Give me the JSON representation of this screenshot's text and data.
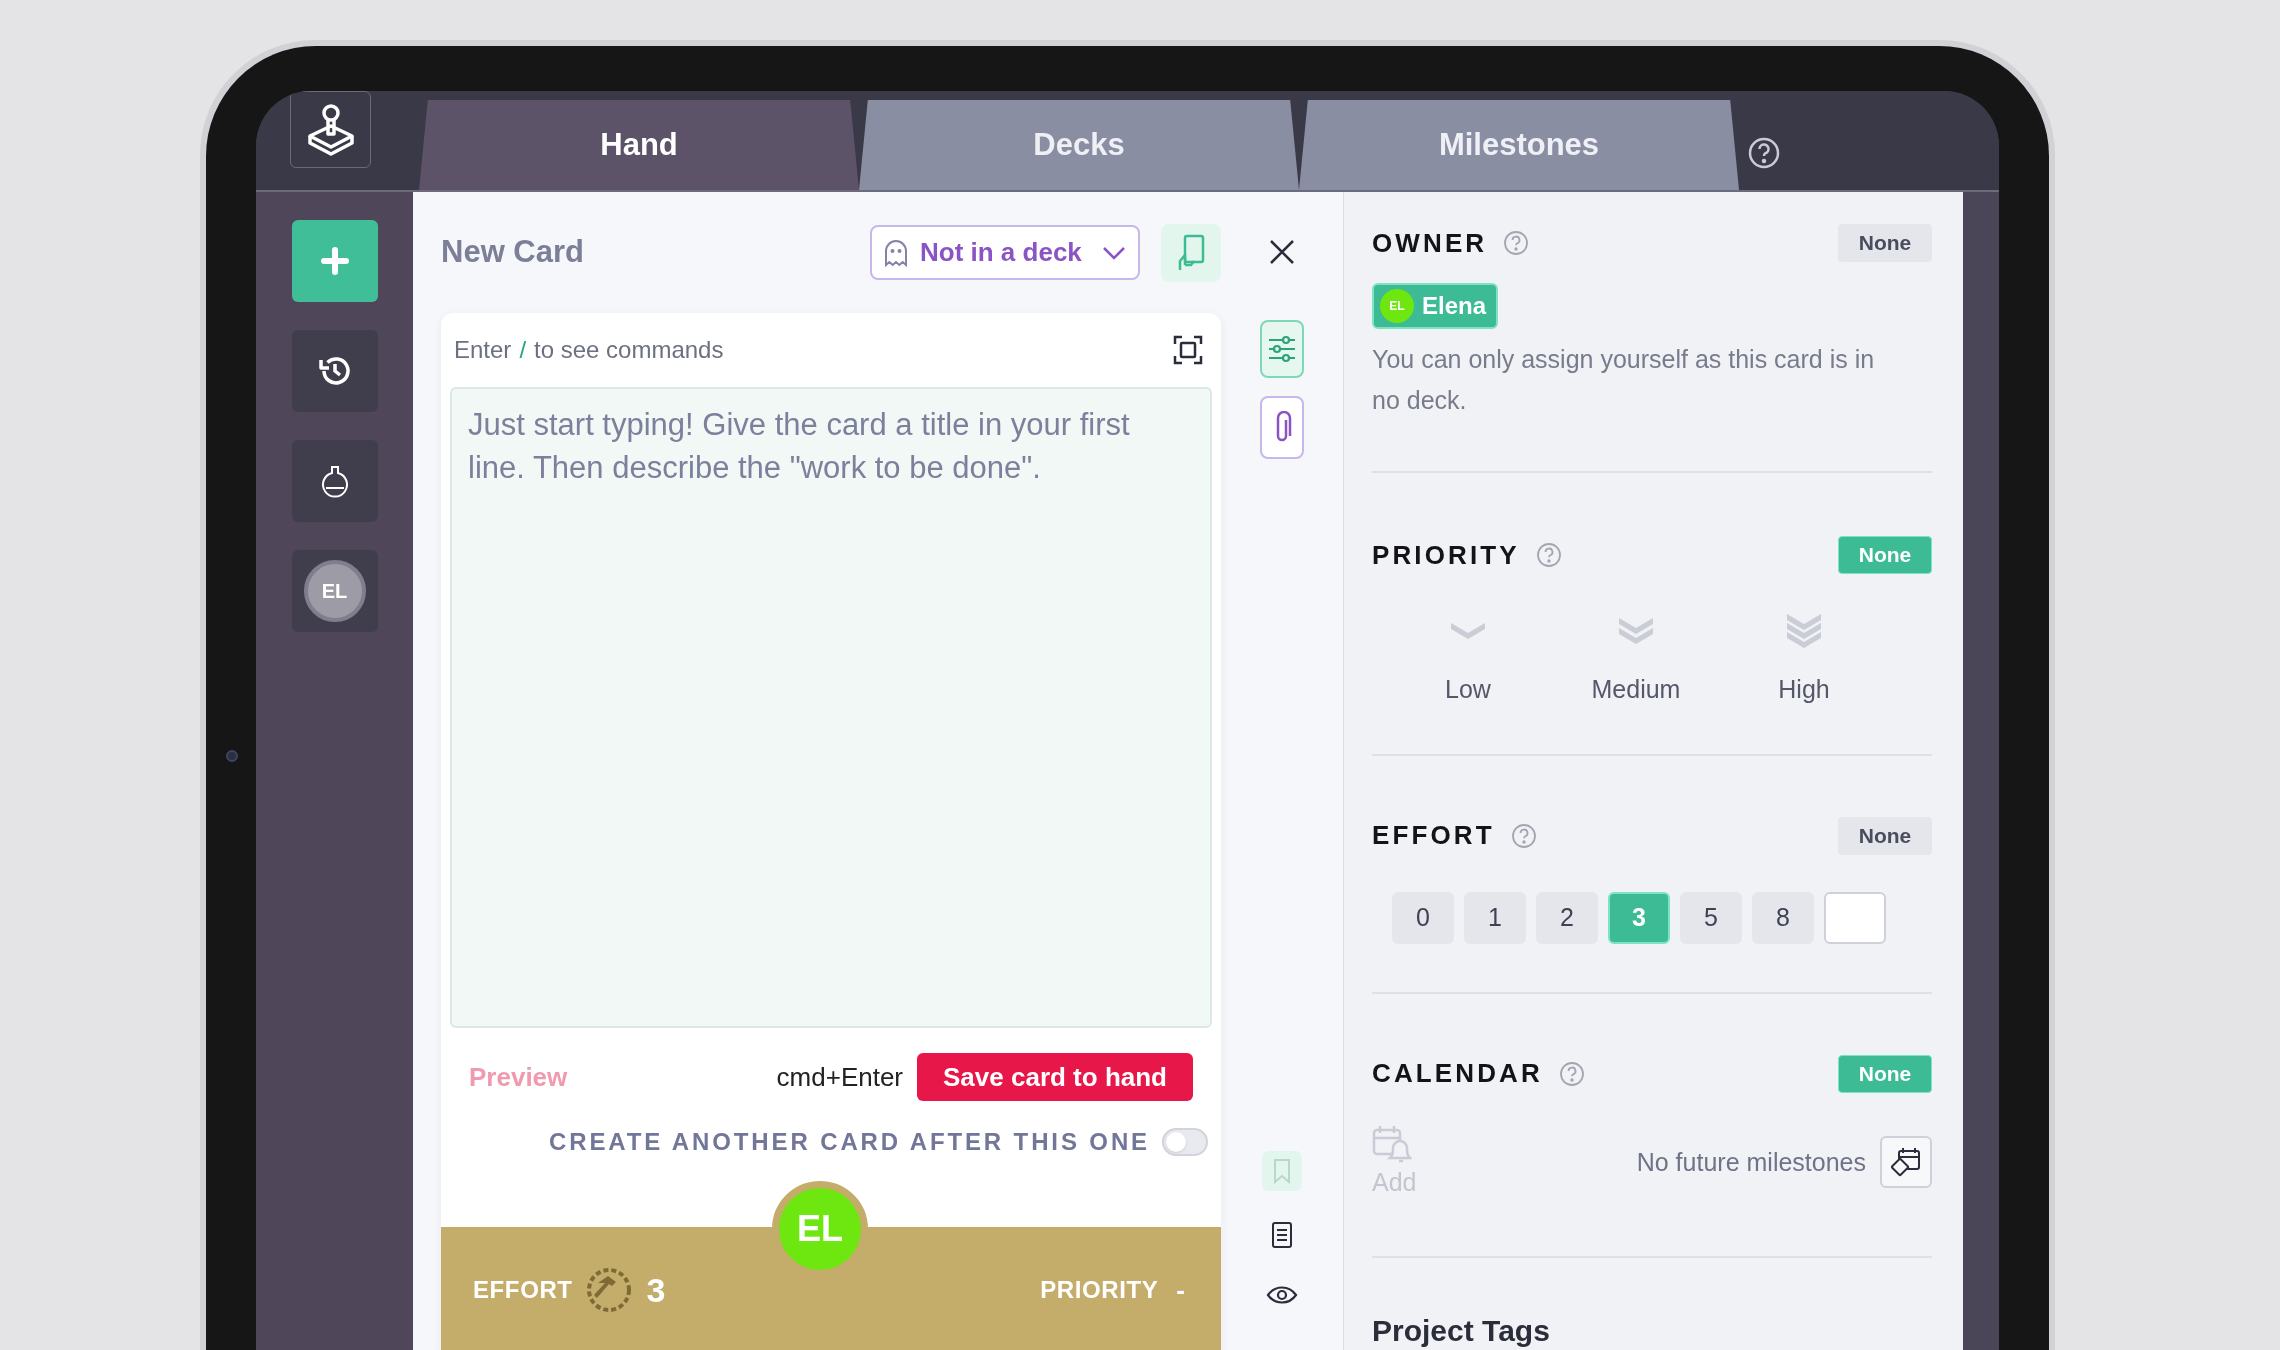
{
  "app_bar": {
    "tabs": [
      {
        "label": "Hand",
        "selected": true
      },
      {
        "label": "Decks",
        "selected": false
      },
      {
        "label": "Milestones",
        "selected": false
      }
    ]
  },
  "sidebar": {
    "items": [
      {
        "kind": "add",
        "selected": true
      },
      {
        "kind": "history",
        "selected": false
      },
      {
        "kind": "flask",
        "selected": false
      },
      {
        "kind": "avatar",
        "initials": "EL",
        "selected": false
      }
    ]
  },
  "card": {
    "title": "New Card",
    "deck_select": {
      "value": "Not in a deck"
    },
    "editor": {
      "hint_before": "Enter",
      "hint_key": "/",
      "hint_after": "to see commands",
      "placeholder": "Just start typing! Give the card a title in your first line. Then describe the \"work to be done\"."
    },
    "preview_link": "Preview",
    "shortcut": "cmd+Enter",
    "save_button": "Save card to hand",
    "create_another": {
      "label": "CREATE ANOTHER CARD AFTER THIS ONE",
      "on": false
    },
    "footer": {
      "effort_label": "EFFORT",
      "effort_value": "3",
      "avatar_initials": "EL",
      "priority_label": "PRIORITY",
      "priority_value": "-"
    }
  },
  "details": {
    "owner": {
      "title": "OWNER",
      "none_badge": {
        "label": "None",
        "selected": false
      },
      "chip": {
        "initials": "EL",
        "name": "Elena"
      },
      "note": "You can only assign yourself as this card is in no deck."
    },
    "priority": {
      "title": "PRIORITY",
      "none_badge": {
        "label": "None",
        "selected": true
      },
      "options": [
        {
          "label": "Low",
          "selected": false
        },
        {
          "label": "Medium",
          "selected": false
        },
        {
          "label": "High",
          "selected": false
        }
      ]
    },
    "effort": {
      "title": "EFFORT",
      "none_badge": {
        "label": "None",
        "selected": false
      },
      "options": [
        {
          "label": "0",
          "selected": false
        },
        {
          "label": "1",
          "selected": false
        },
        {
          "label": "2",
          "selected": false
        },
        {
          "label": "3",
          "selected": true
        },
        {
          "label": "5",
          "selected": false
        },
        {
          "label": "8",
          "selected": false
        }
      ]
    },
    "calendar": {
      "title": "CALENDAR",
      "none_badge": {
        "label": "None",
        "selected": true
      },
      "add_label": "Add",
      "empty_text": "No future milestones"
    },
    "project_tags": {
      "title": "Project Tags"
    }
  }
}
